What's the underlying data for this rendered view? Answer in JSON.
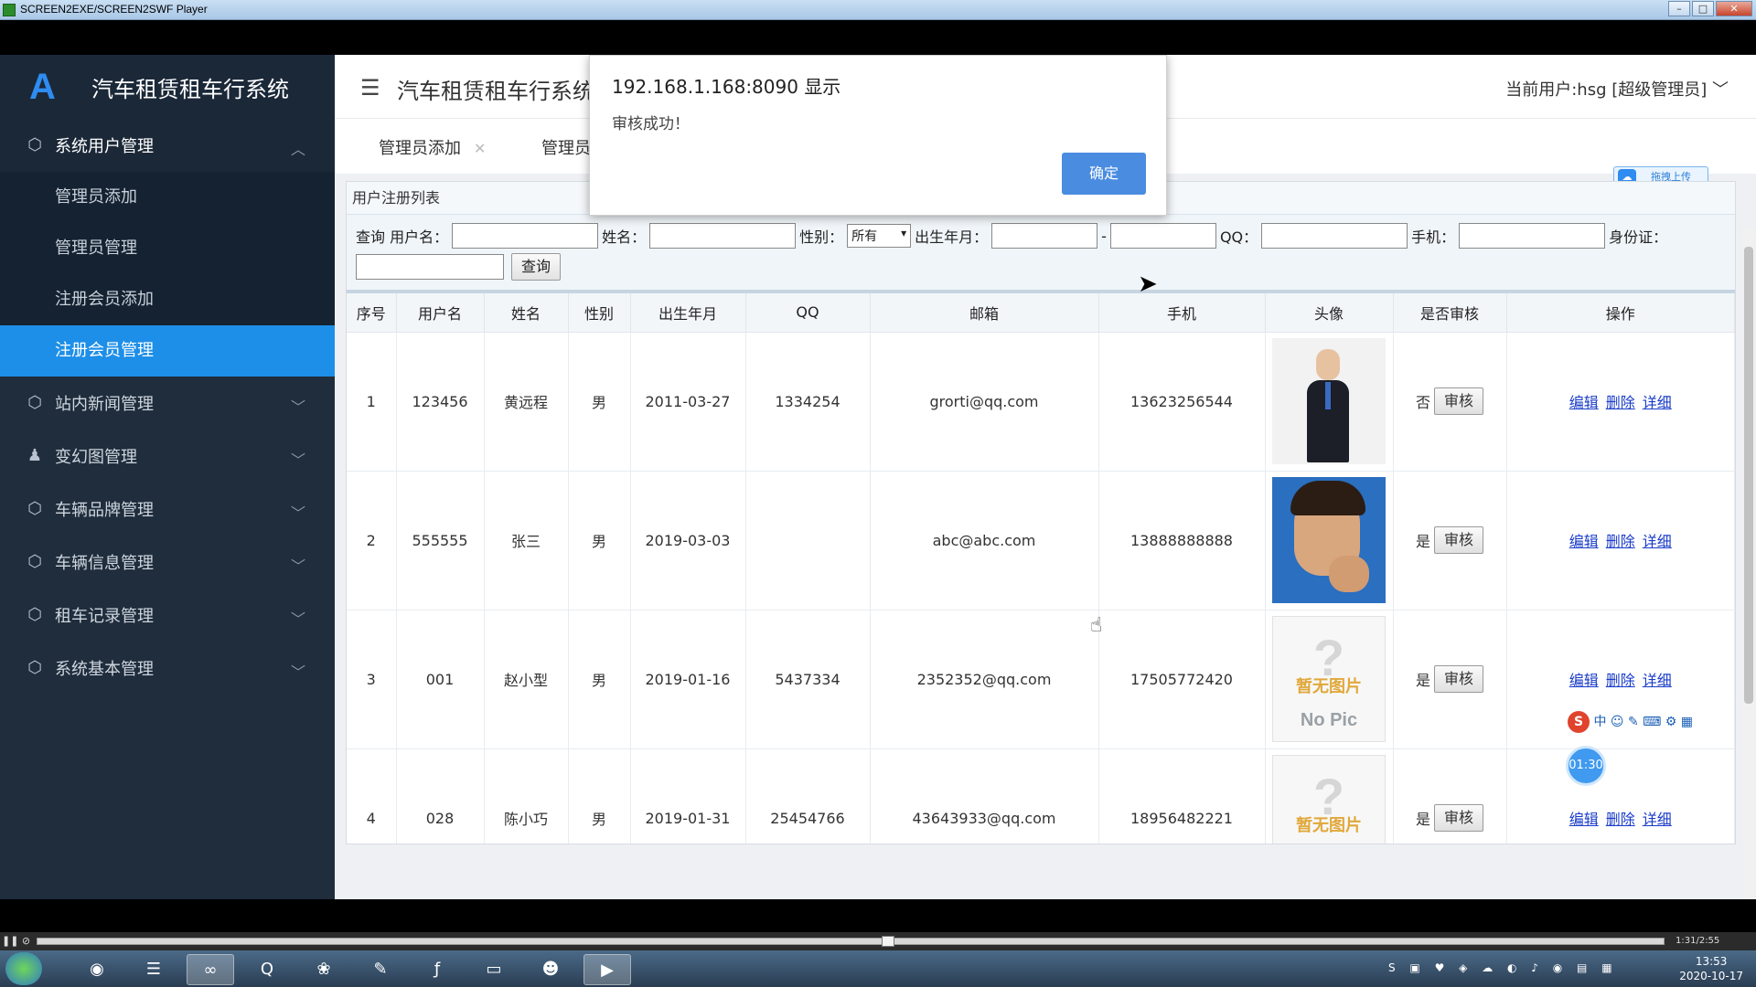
{
  "player": {
    "title": "SCREEN2EXE/SCREEN2SWF Player",
    "time": "1:31/2:55"
  },
  "sidebar": {
    "logo": "A",
    "brand": "汽车租赁租车行系统",
    "groups": [
      {
        "label": "系统用户管理",
        "icon": "cube-icon",
        "open": true,
        "items": [
          {
            "label": "管理员添加"
          },
          {
            "label": "管理员管理"
          },
          {
            "label": "注册会员添加"
          },
          {
            "label": "注册会员管理",
            "active": true
          }
        ]
      },
      {
        "label": "站内新闻管理",
        "icon": "cube-icon"
      },
      {
        "label": "变幻图管理",
        "icon": "user-icon"
      },
      {
        "label": "车辆品牌管理",
        "icon": "cube-icon"
      },
      {
        "label": "车辆信息管理",
        "icon": "cube-icon"
      },
      {
        "label": "租车记录管理",
        "icon": "cube-icon"
      },
      {
        "label": "系统基本管理",
        "icon": "cube-icon"
      }
    ]
  },
  "header": {
    "title": "汽车租赁租车行系统",
    "current_user": "当前用户:hsg [超级管理员]"
  },
  "tabs": [
    {
      "label": "管理员添加"
    },
    {
      "label": "管理员"
    }
  ],
  "upload_badge": "拖拽上传",
  "panel": {
    "title": "用户注册列表",
    "filter": {
      "query_label": "查询",
      "username_label": "用户名：",
      "name_label": "姓名：",
      "gender_label": "性别：",
      "gender_value": "所有",
      "birth_label": "出生年月：",
      "birth_sep": "-",
      "qq_label": "QQ：",
      "phone_label": "手机：",
      "idcard_label": "身份证：",
      "search_button": "查询"
    },
    "columns": [
      "序号",
      "用户名",
      "姓名",
      "性别",
      "出生年月",
      "QQ",
      "邮箱",
      "手机",
      "头像",
      "是否审核",
      "操作"
    ],
    "rows": [
      {
        "no": "1",
        "username": "123456",
        "name": "黄远程",
        "gender": "男",
        "birth": "2011-03-27",
        "qq": "1334254",
        "email": "grorti@qq.com",
        "phone": "13623256544",
        "avatar": "photo-man-suit",
        "audited": "否"
      },
      {
        "no": "2",
        "username": "555555",
        "name": "张三",
        "gender": "男",
        "birth": "2019-03-03",
        "qq": "",
        "email": "abc@abc.com",
        "phone": "13888888888",
        "avatar": "photo-young-man",
        "audited": "是"
      },
      {
        "no": "3",
        "username": "001",
        "name": "赵小型",
        "gender": "男",
        "birth": "2019-01-16",
        "qq": "5437334",
        "email": "2352352@qq.com",
        "phone": "17505772420",
        "avatar": "no-picture",
        "audited": "是"
      },
      {
        "no": "4",
        "username": "028",
        "name": "陈小巧",
        "gender": "男",
        "birth": "2019-01-31",
        "qq": "25454766",
        "email": "43643933@qq.com",
        "phone": "18956482221",
        "avatar": "no-picture",
        "audited": "是"
      }
    ],
    "audit_button": "审核",
    "ops": {
      "edit": "编辑",
      "delete": "删除",
      "detail": "详细"
    },
    "no_picture_cn": "暂无图片",
    "no_picture_en": "No Pic",
    "no_picture_mark": "?"
  },
  "modal": {
    "title": "192.168.1.168:8090 显示",
    "message": "审核成功！",
    "ok": "确定"
  },
  "ime": {
    "logo": "S",
    "mode": "中"
  },
  "timer": "01:30",
  "clock": {
    "time": "13:53",
    "date": "2020-10-17"
  }
}
